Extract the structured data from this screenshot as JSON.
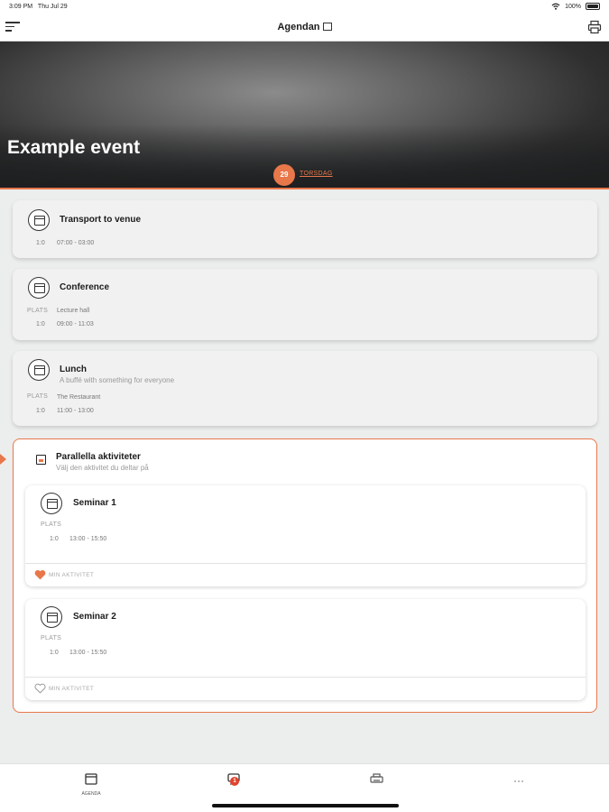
{
  "status_bar": {
    "time": "3:09 PM",
    "date": "Thu Jul 29",
    "battery": "100%"
  },
  "nav": {
    "title": "Agendan"
  },
  "hero": {
    "event_title": "Example event",
    "date_number": "29",
    "date_label": "TORSDAG"
  },
  "agenda": [
    {
      "title": "Transport to venue",
      "subtitle": "",
      "place_label": "",
      "place": "",
      "duration": "1:0",
      "time": "07:00 - 03:00"
    },
    {
      "title": "Conference",
      "subtitle": "",
      "place_label": "PLATS",
      "place": "Lecture hall",
      "duration": "1:0",
      "time": "09:00 - 11:03"
    },
    {
      "title": "Lunch",
      "subtitle": "A buffé with something for everyone",
      "place_label": "PLATS",
      "place": "The Restaurant",
      "duration": "1:0",
      "time": "11:00 - 13:00"
    }
  ],
  "parallel": {
    "title": "Parallella aktiviteter",
    "subtitle": "Välj den aktivitet du deltar på",
    "items": [
      {
        "title": "Seminar 1",
        "place_label": "PLATS",
        "duration": "1:0",
        "time": "13:00 - 15:50",
        "favorite_label": "MIN AKTIVITET",
        "favorited": true
      },
      {
        "title": "Seminar 2",
        "place_label": "PLATS",
        "duration": "1:0",
        "time": "13:00 - 15:50",
        "favorite_label": "MIN AKTIVITET",
        "favorited": false
      }
    ]
  },
  "tabbar": {
    "agenda_label": "AGENDA",
    "messages_badge": "1"
  },
  "colors": {
    "accent": "#e8774a",
    "badge": "#e0442f"
  }
}
